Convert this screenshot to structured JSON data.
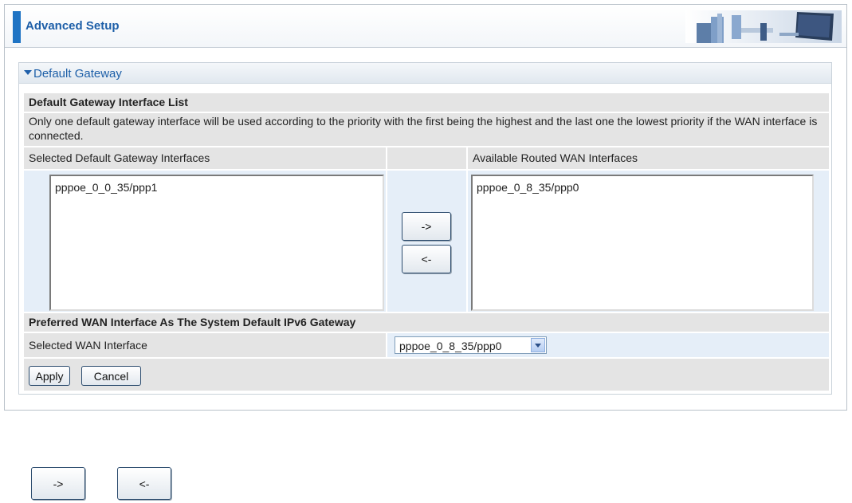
{
  "header": {
    "title": "Advanced Setup"
  },
  "section": {
    "title": "Default Gateway",
    "list_heading": "Default Gateway Interface List",
    "description": "Only one default gateway interface will be used according to the priority with the first being the highest and the last one the lowest priority if the WAN interface is connected.",
    "selected_label": "Selected Default Gateway Interfaces",
    "available_label": "Available Routed WAN Interfaces",
    "selected_items": [
      "pppoe_0_0_35/ppp1"
    ],
    "available_items": [
      "pppoe_0_8_35/ppp0"
    ],
    "move_right_label": "->",
    "move_left_label": "<-",
    "ipv6_heading": "Preferred WAN Interface As The System Default IPv6 Gateway",
    "wan_label": "Selected WAN Interface",
    "wan_value": "pppoe_0_8_35/ppp0",
    "apply_label": "Apply",
    "cancel_label": "Cancel"
  },
  "legend": {
    "move_right_label": "->",
    "move_left_label": "<-"
  },
  "colors": {
    "accent": "#1f74c4",
    "title_blue": "#1d5fa8",
    "row_gray": "#e4e4e4",
    "row_blue": "#e5eef8"
  }
}
